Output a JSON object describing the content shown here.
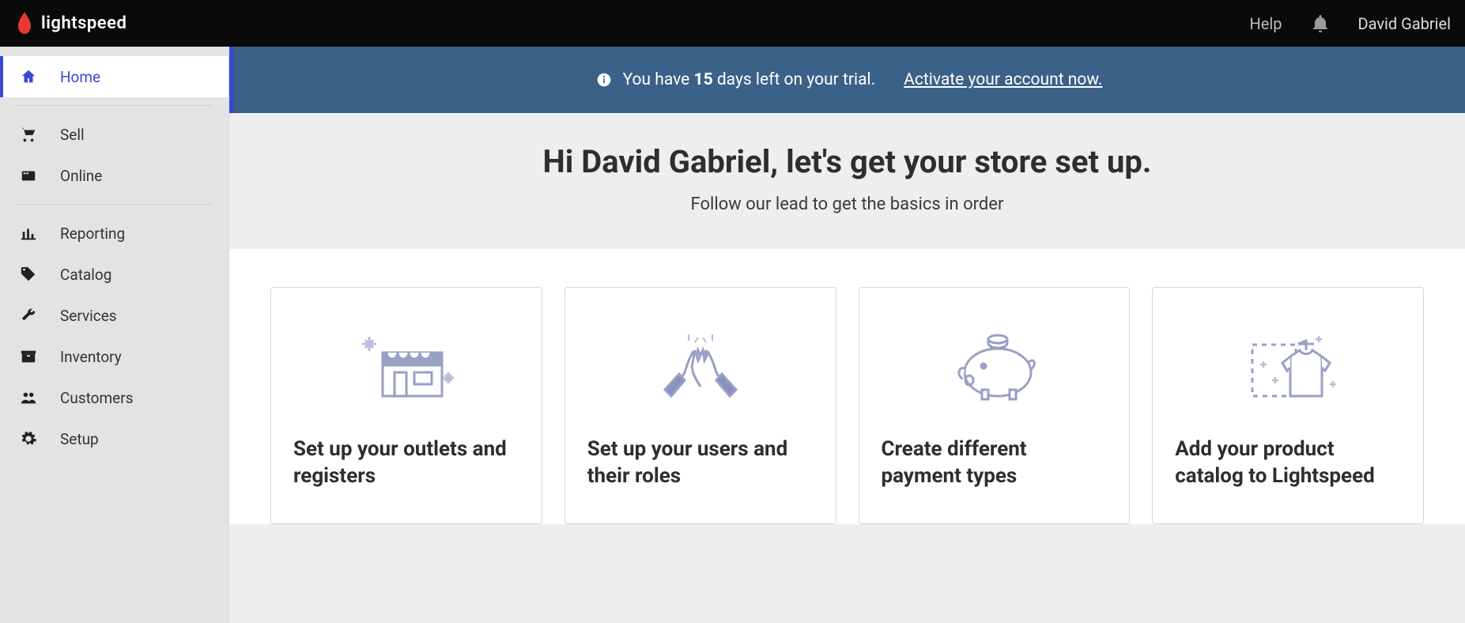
{
  "header": {
    "brand": "lightspeed",
    "help_label": "Help",
    "user_name": "David Gabriel"
  },
  "sidebar": {
    "items": [
      {
        "label": "Home",
        "icon": "home-icon",
        "active": true
      },
      {
        "label": "Sell",
        "icon": "cart-icon"
      },
      {
        "label": "Online",
        "icon": "storefront-icon"
      },
      {
        "label": "Reporting",
        "icon": "chart-icon"
      },
      {
        "label": "Catalog",
        "icon": "tag-icon"
      },
      {
        "label": "Services",
        "icon": "wrench-icon"
      },
      {
        "label": "Inventory",
        "icon": "box-icon"
      },
      {
        "label": "Customers",
        "icon": "people-icon"
      },
      {
        "label": "Setup",
        "icon": "gear-icon"
      }
    ]
  },
  "banner": {
    "prefix": "You have ",
    "days": "15",
    "suffix": " days left on your trial.",
    "cta": "Activate your account now."
  },
  "hero": {
    "title": "Hi David Gabriel, let's get your store set up.",
    "subtitle": "Follow our lead to get the basics in order"
  },
  "cards": [
    {
      "title": "Set up your outlets and registers"
    },
    {
      "title": "Set up your users and their roles"
    },
    {
      "title": "Create different payment types"
    },
    {
      "title": "Add your product catalog to Lightspeed"
    }
  ]
}
